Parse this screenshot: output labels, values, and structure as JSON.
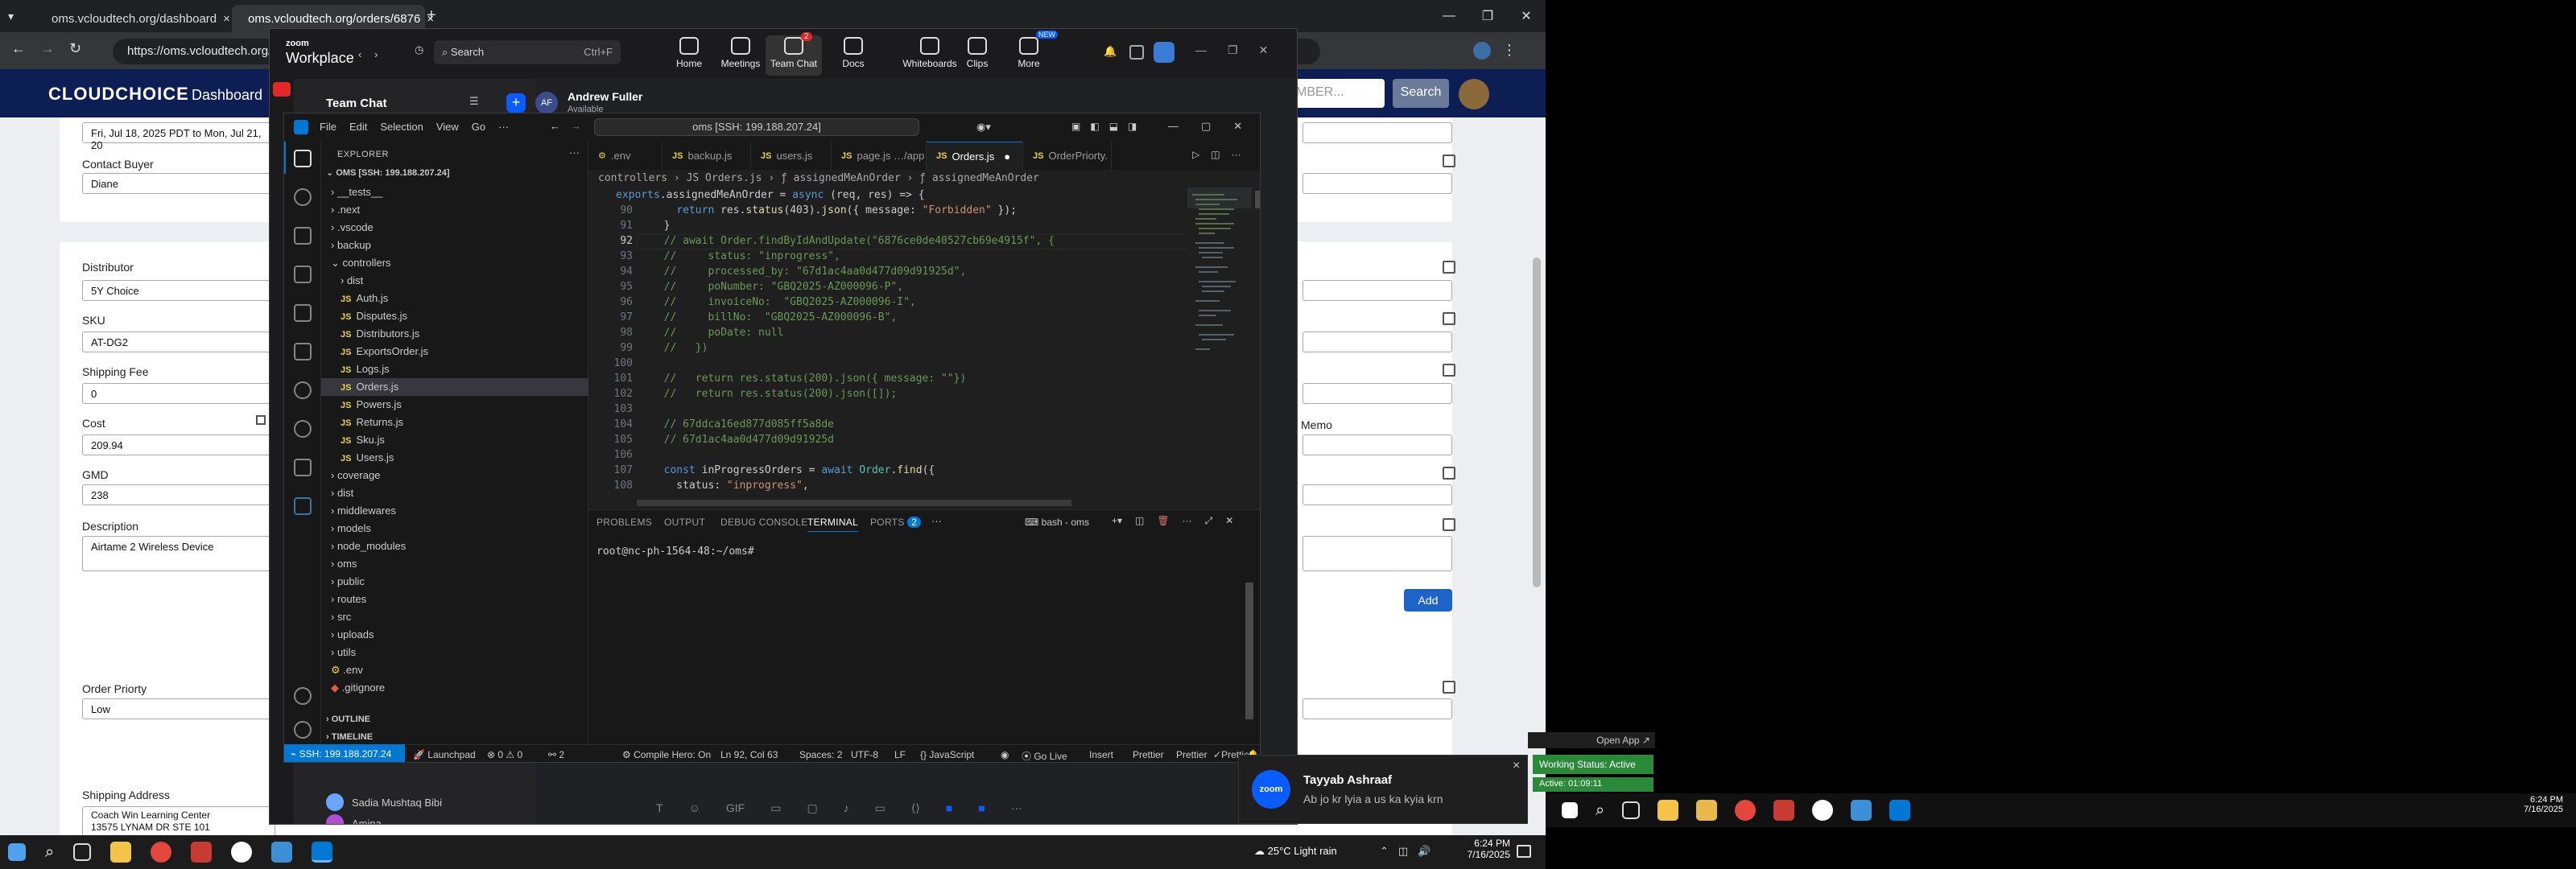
{
  "browser": {
    "tabs": [
      {
        "title": "oms.vcloudtech.org/dashboard",
        "close": "×"
      },
      {
        "title": "oms.vcloudtech.org/orders/6876",
        "close": "×"
      }
    ],
    "new_tab": "+",
    "url": "https://oms.vcloudtech.org/dashboard",
    "win_controls": [
      "—",
      "❐",
      "✕"
    ]
  },
  "webapp": {
    "logo": "CLOUDCHOICE",
    "nav_dashboard": "Dashboard",
    "search_placeholder": "MBER...",
    "search_button": "Search",
    "date_range": "Fri, Jul 18, 2025 PDT to Mon, Jul 21, 20",
    "contact_buyer_label": "Contact Buyer",
    "contact_buyer": "Diane",
    "distributor_label": "Distributor",
    "distributor": "5Y Choice",
    "sku_label": "SKU",
    "sku": "AT-DG2",
    "shipping_fee_label": "Shipping Fee",
    "shipping_fee": "0",
    "cost_label": "Cost",
    "cost": "209.94",
    "gmd_label": "GMD",
    "gmd": "238",
    "description_label": "Description",
    "description": "Airtame 2 Wireless Device",
    "memo_label": "Memo",
    "add_button": "Add",
    "order_priority_label": "Order Priorty",
    "order_priority": "Low",
    "shipping_address_label": "Shipping Address",
    "shipping_address_line1": "Coach Win Learning Center",
    "shipping_address_line2": "13575 LYNAM DR STE 101"
  },
  "zoom": {
    "brand_top": "zoom",
    "brand": "Workplace",
    "search": "Search",
    "search_shortcut": "Ctrl+F",
    "nav": [
      {
        "label": "Home",
        "icon": "home-icon"
      },
      {
        "label": "Meetings",
        "icon": "video-icon"
      },
      {
        "label": "Team Chat",
        "icon": "chat-icon",
        "badge": "2"
      },
      {
        "label": "Docs",
        "icon": "docs-icon"
      },
      {
        "label": "Whiteboards",
        "icon": "whiteboard-icon"
      },
      {
        "label": "Clips",
        "icon": "clips-icon"
      },
      {
        "label": "More",
        "icon": "more-icon",
        "badge": "NEW"
      }
    ],
    "team_chat_title": "Team Chat",
    "chat_user": "Andrew Fuller",
    "chat_user_initials": "AF",
    "chat_status": "Available",
    "contacts": [
      {
        "name": "Sadia Mushtaq Bibi"
      },
      {
        "name": "Amina"
      }
    ]
  },
  "vscode": {
    "menu": [
      "File",
      "Edit",
      "Selection",
      "View",
      "Go",
      "···"
    ],
    "command_center": "oms [SSH: 199.188.207.24]",
    "explorer_title": "EXPLORER",
    "workspace": "OMS [SSH: 199.188.207.24]",
    "tree": [
      {
        "name": "__tests__",
        "type": "folder",
        "depth": 1,
        "open": false
      },
      {
        "name": ".next",
        "type": "folder",
        "depth": 1,
        "open": false
      },
      {
        "name": ".vscode",
        "type": "folder",
        "depth": 1,
        "open": false
      },
      {
        "name": "backup",
        "type": "folder",
        "depth": 1,
        "open": false
      },
      {
        "name": "controllers",
        "type": "folder",
        "depth": 1,
        "open": true
      },
      {
        "name": "dist",
        "type": "folder",
        "depth": 2,
        "open": false
      },
      {
        "name": "Auth.js",
        "type": "js",
        "depth": 2
      },
      {
        "name": "Disputes.js",
        "type": "js",
        "depth": 2
      },
      {
        "name": "Distributors.js",
        "type": "js",
        "depth": 2
      },
      {
        "name": "ExportsOrder.js",
        "type": "js",
        "depth": 2
      },
      {
        "name": "Logs.js",
        "type": "js",
        "depth": 2
      },
      {
        "name": "Orders.js",
        "type": "js",
        "depth": 2,
        "selected": true
      },
      {
        "name": "Powers.js",
        "type": "js",
        "depth": 2
      },
      {
        "name": "Returns.js",
        "type": "js",
        "depth": 2
      },
      {
        "name": "Sku.js",
        "type": "js",
        "depth": 2
      },
      {
        "name": "Users.js",
        "type": "js",
        "depth": 2
      },
      {
        "name": "coverage",
        "type": "folder",
        "depth": 1,
        "open": false
      },
      {
        "name": "dist",
        "type": "folder",
        "depth": 1,
        "open": false
      },
      {
        "name": "middlewares",
        "type": "folder",
        "depth": 1,
        "open": false
      },
      {
        "name": "models",
        "type": "folder",
        "depth": 1,
        "open": false
      },
      {
        "name": "node_modules",
        "type": "folder",
        "depth": 1,
        "open": false
      },
      {
        "name": "oms",
        "type": "folder",
        "depth": 1,
        "open": false
      },
      {
        "name": "public",
        "type": "folder",
        "depth": 1,
        "open": false
      },
      {
        "name": "routes",
        "type": "folder",
        "depth": 1,
        "open": false
      },
      {
        "name": "src",
        "type": "folder",
        "depth": 1,
        "open": false
      },
      {
        "name": "uploads",
        "type": "folder",
        "depth": 1,
        "open": false
      },
      {
        "name": "utils",
        "type": "folder",
        "depth": 1,
        "open": false
      },
      {
        "name": ".env",
        "type": "env",
        "depth": 1
      },
      {
        "name": ".gitignore",
        "type": "git",
        "depth": 1
      }
    ],
    "outline": "OUTLINE",
    "timeline": "TIMELINE",
    "tabs": [
      {
        "name": ".env",
        "icon": "⚙"
      },
      {
        "name": "backup.js",
        "icon": "JS"
      },
      {
        "name": "users.js",
        "icon": "JS"
      },
      {
        "name": "page.js …/app",
        "icon": "JS"
      },
      {
        "name": "Orders.js",
        "icon": "JS",
        "active": true,
        "dirty": "●"
      },
      {
        "name": "OrderPriorty.",
        "icon": "JS"
      }
    ],
    "breadcrumb": "controllers  ›  JS Orders.js  ›  ƒ assignedMeAnOrder  ›  ƒ assignedMeAnOrder",
    "code_lines": [
      {
        "n": "",
        "t": "exports.assignedMeAnOrder = async (req, res) => {",
        "c": "sticky"
      },
      {
        "n": "90",
        "t": "    return res.status(403).json({ message: \"Forbidden\" });",
        "c": "code"
      },
      {
        "n": "91",
        "t": "  }",
        "c": "code"
      },
      {
        "n": "92",
        "t": "  // await Order.findByIdAndUpdate(\"6876ce0de40527cb69e4915f\", {",
        "c": "cm"
      },
      {
        "n": "93",
        "t": "  //     status: \"inprogress\",",
        "c": "cm"
      },
      {
        "n": "94",
        "t": "  //     processed_by: \"67d1ac4aa0d477d09d91925d\",",
        "c": "cm"
      },
      {
        "n": "95",
        "t": "  //     poNumber: \"GBQ2025-AZ000096-P\",",
        "c": "cm"
      },
      {
        "n": "96",
        "t": "  //     invoiceNo:  \"GBQ2025-AZ000096-I\",",
        "c": "cm"
      },
      {
        "n": "97",
        "t": "  //     billNo:  \"GBQ2025-AZ000096-B\",",
        "c": "cm"
      },
      {
        "n": "98",
        "t": "  //     poDate: null",
        "c": "cm"
      },
      {
        "n": "99",
        "t": "  //   })",
        "c": "cm"
      },
      {
        "n": "100",
        "t": "",
        "c": "code"
      },
      {
        "n": "101",
        "t": "  //   return res.status(200).json({ message: \"\"})",
        "c": "cm"
      },
      {
        "n": "102",
        "t": "  //   return res.status(200).json([]);",
        "c": "cm"
      },
      {
        "n": "103",
        "t": "",
        "c": "code"
      },
      {
        "n": "104",
        "t": "  // 67ddca16ed877d085ff5a8de",
        "c": "cm"
      },
      {
        "n": "105",
        "t": "  // 67d1ac4aa0d477d09d91925d",
        "c": "cm"
      },
      {
        "n": "106",
        "t": "",
        "c": "code"
      },
      {
        "n": "107",
        "t": "  const inProgressOrders = await Order.find({",
        "c": "code"
      },
      {
        "n": "108",
        "t": "    status: \"inprogress\",",
        "c": "code"
      }
    ],
    "current_line": "92",
    "panel_tabs": [
      "PROBLEMS",
      "OUTPUT",
      "DEBUG CONSOLE",
      "TERMINAL",
      "PORTS"
    ],
    "ports_count": "2",
    "terminal_profile": "bash - oms",
    "terminal_prompt": "root@nc-ph-1564-48:~/oms#",
    "status": {
      "remote": "SSH: 199.188.207.24",
      "launchpad": "Launchpad",
      "errors": "0",
      "warnings": "0",
      "ports": "2",
      "compile": "Compile Hero: On",
      "position": "Ln 92, Col 63",
      "spaces": "Spaces: 2",
      "encoding": "UTF-8",
      "eol": "LF",
      "language": "JavaScript",
      "golive": "Go Live",
      "insert": "Insert",
      "prettier1": "Prettier",
      "prettier2": "Prettier",
      "prettier3": "Prettier"
    }
  },
  "notification": {
    "app": "zoom",
    "title": "Tayyab Ashraaf",
    "message": "Ab jo kr lyia a us ka kyia krn",
    "close": "×"
  },
  "right_panel": {
    "open_app": "Open App ↗",
    "working_status": "Working Status: Active",
    "active_time": "Active: 01:09:11"
  },
  "taskbar": {
    "weather": "25°C  Light rain",
    "time": "6:24 PM",
    "date": "7/16/2025"
  },
  "right_taskbar": {
    "time": "6:24 PM",
    "date": "7/16/2025"
  },
  "colors": {
    "vscode_accent": "#0078d4",
    "zoom_accent": "#0b5cff",
    "webapp_nav": "#0d1e55",
    "active_status": "#2a8a3a"
  }
}
